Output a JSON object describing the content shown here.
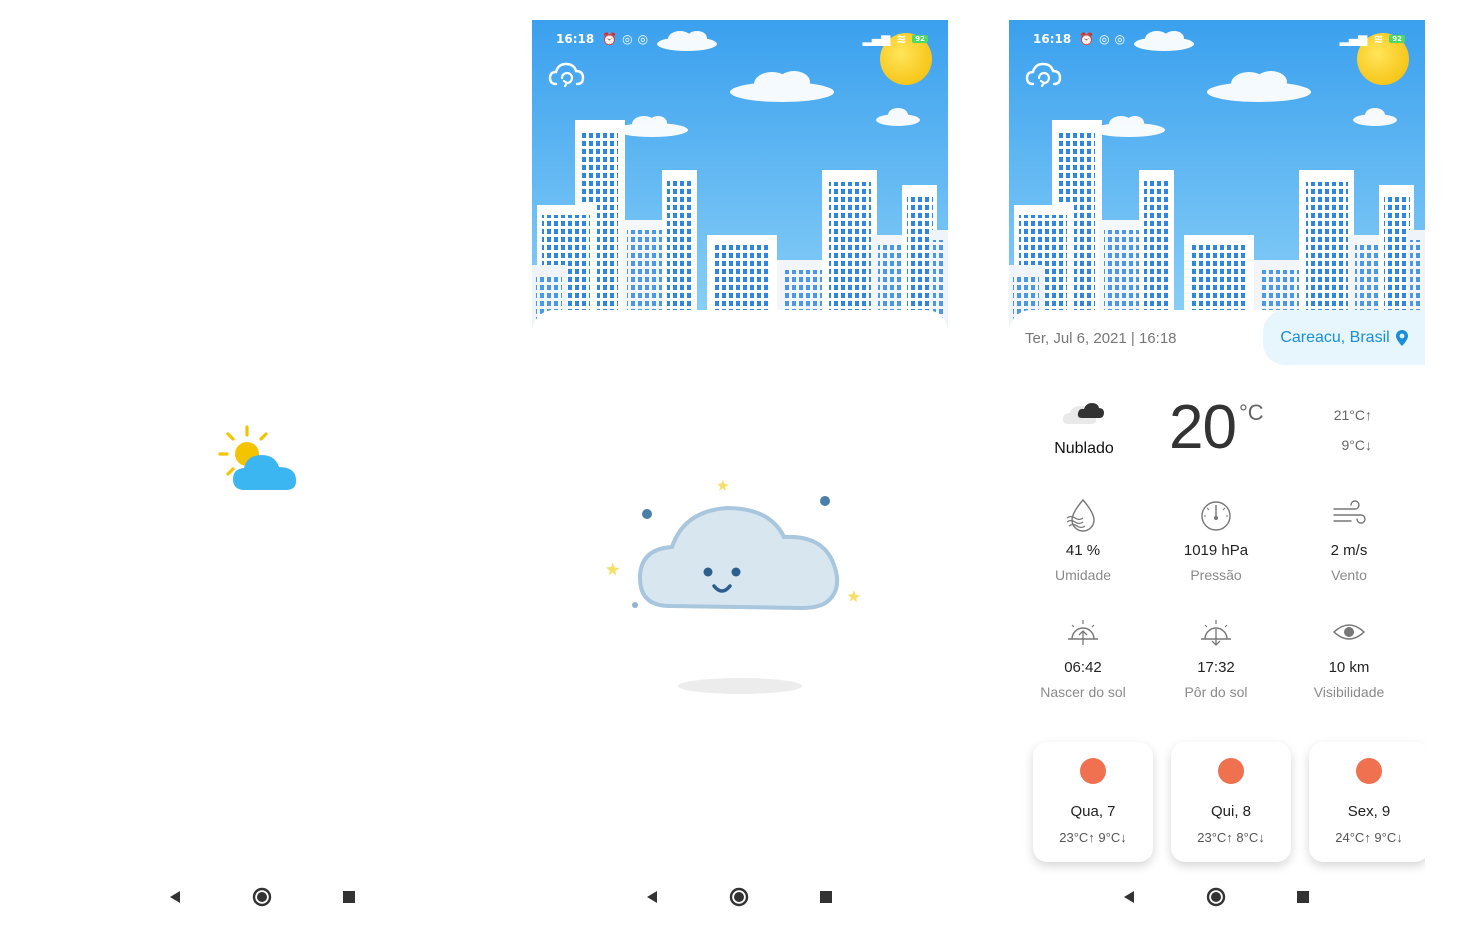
{
  "status_bar": {
    "time": "16:18",
    "battery": "92"
  },
  "nav": {
    "back_icon": "triangle-back-icon",
    "home_icon": "circle-home-icon",
    "recent_icon": "square-recent-icon"
  },
  "weather": {
    "datetime": "Ter, Jul 6, 2021 | 16:18",
    "location": "Careacu, Brasil",
    "condition": "Nublado",
    "temperature": "20",
    "temp_unit": "°C",
    "max_temp": "21°C↑",
    "min_temp": "9°C↓",
    "stats": [
      {
        "value": "41 %",
        "label": "Umidade",
        "icon": "humidity-icon"
      },
      {
        "value": "1019 hPa",
        "label": "Pressão",
        "icon": "pressure-gauge-icon"
      },
      {
        "value": "2 m/s",
        "label": "Vento",
        "icon": "wind-icon"
      },
      {
        "value": "06:42",
        "label": "Nascer do sol",
        "icon": "sunrise-icon"
      },
      {
        "value": "17:32",
        "label": "Pôr do sol",
        "icon": "sunset-icon"
      },
      {
        "value": "10 km",
        "label": "Visibilidade",
        "icon": "eye-icon"
      }
    ],
    "forecast": [
      {
        "day": "Qua, 7",
        "range": "23°C↑  9°C↓"
      },
      {
        "day": "Qui, 8",
        "range": "23°C↑  8°C↓"
      },
      {
        "day": "Sex, 9",
        "range": "24°C↑  9°C↓"
      }
    ]
  },
  "colors": {
    "accent": "#1a8ed8",
    "sky_top": "#3aa0ee",
    "sky_bottom": "#8fd3f8",
    "forecast_dot": "#f07150"
  }
}
